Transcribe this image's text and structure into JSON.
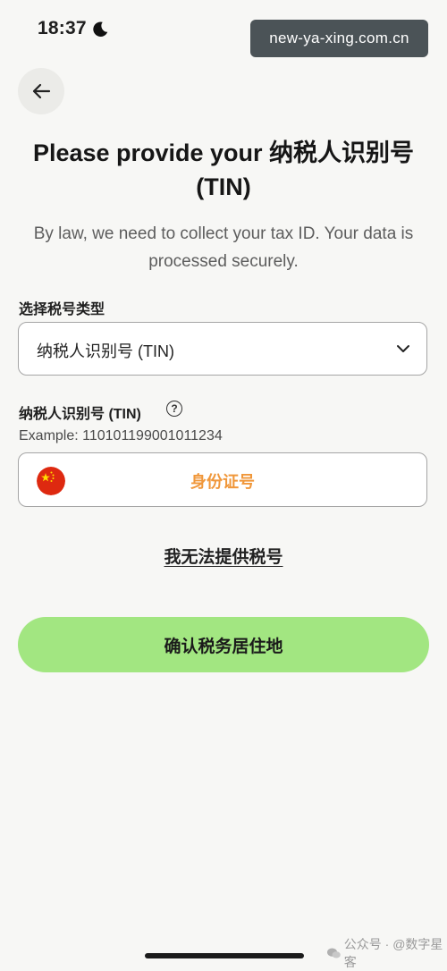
{
  "status_bar": {
    "time": "18:37",
    "url_badge": "new-ya-xing.com.cn"
  },
  "page": {
    "title": "Please provide your 纳税人识别号 (TIN)",
    "subtitle": "By law, we need to collect your tax ID. Your data is processed securely."
  },
  "tax_type": {
    "label": "选择税号类型",
    "selected": "纳税人识别号 (TIN)"
  },
  "tin": {
    "label": "纳税人识别号 (TIN)",
    "help_icon_glyph": "?",
    "example": "Example: 110101199001011234",
    "value": "身份证号",
    "value_color": "#f0973a"
  },
  "actions": {
    "cannot_provide": "我无法提供税号",
    "confirm": "确认税务居住地",
    "confirm_color": "#a2e681"
  },
  "watermark": {
    "text": "公众号 · @数字星客"
  },
  "icons": {
    "back": "arrow-left-icon",
    "moon": "moon-icon",
    "signal": "signal-icon",
    "wifi": "wifi-icon",
    "battery": "battery-icon",
    "chevron": "chevron-down-icon",
    "help": "question-circle-icon",
    "flag": "china-flag-icon"
  }
}
